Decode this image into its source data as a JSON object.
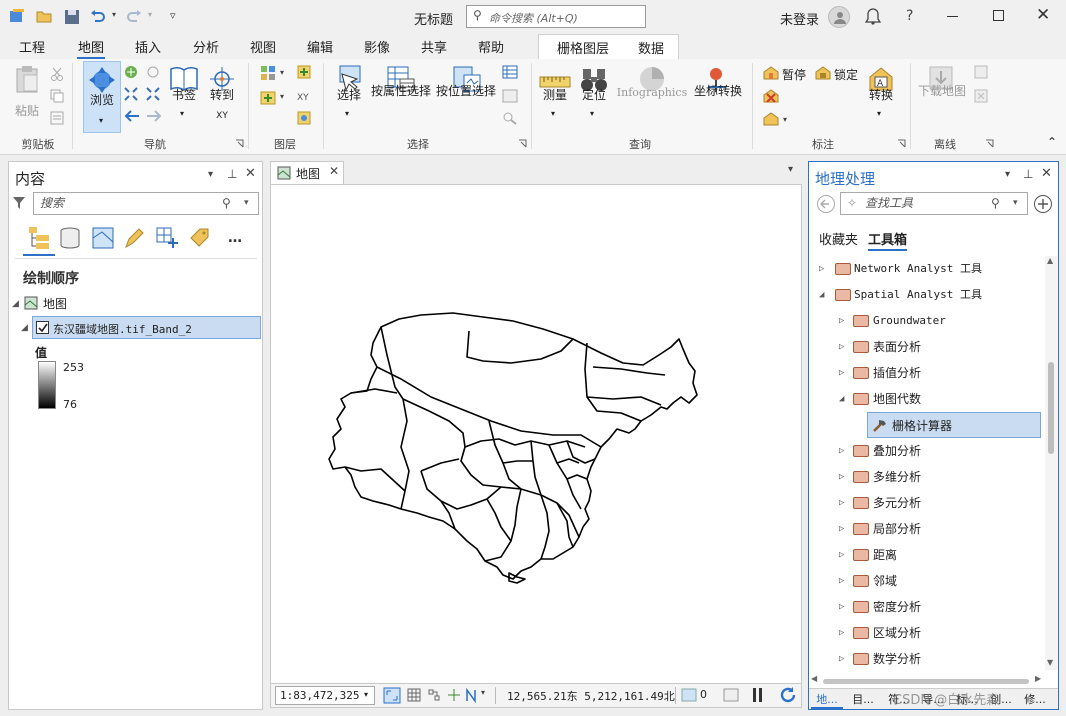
{
  "titlebar": {
    "doc_title": "无标题",
    "command_search_placeholder": "命令搜索 (Alt+Q)",
    "login_label": "未登录",
    "help_label": "?"
  },
  "ribbon_tabs": [
    "工程",
    "地图",
    "插入",
    "分析",
    "视图",
    "编辑",
    "影像",
    "共享",
    "帮助"
  ],
  "ribbon_active_tab": "地图",
  "context_tabs": [
    "栅格图层",
    "数据"
  ],
  "ribbon": {
    "paste": "粘贴",
    "browse": "浏览",
    "bookmark": "书签",
    "goto_xy": "转到",
    "goto_xy_sub": "XY",
    "select": "选择",
    "select_by_attr": "按属性选择",
    "select_by_loc": "按位置选择",
    "measure": "测量",
    "locate": "定位",
    "infographics": "Infographics",
    "coord_convert": "坐标转换",
    "pause": "暂停",
    "lock": "锁定",
    "convert": "转换",
    "download_map": "下载地图",
    "groups": {
      "clipboard": "剪贴板",
      "navigate": "导航",
      "layer": "图层",
      "selection": "选择",
      "inquiry": "查询",
      "labeling": "标注",
      "offline": "离线"
    }
  },
  "contents": {
    "title": "内容",
    "search_placeholder": "搜索",
    "drawing_order": "绘制顺序",
    "map_name": "地图",
    "layer_name": "东汉疆域地图.tif_Band_2",
    "layer_checked": true,
    "legend_title": "值",
    "legend_max": "253",
    "legend_min": "76"
  },
  "map_view": {
    "tab_label": "地图",
    "scale": "1:83,472,325",
    "coords": "12,565.21东 5,212,161.49北",
    "selected_count": "0"
  },
  "geoprocessing": {
    "title": "地理处理",
    "search_placeholder": "查找工具",
    "tabs": [
      "收藏夹",
      "工具箱"
    ],
    "active_tab": "工具箱",
    "tree": [
      {
        "label": "Network Analyst 工具",
        "level": 0,
        "expanded": false
      },
      {
        "label": "Spatial Analyst 工具",
        "level": 0,
        "expanded": true
      },
      {
        "label": "Groundwater",
        "level": 1,
        "expanded": false
      },
      {
        "label": "表面分析",
        "level": 1,
        "expanded": false
      },
      {
        "label": "插值分析",
        "level": 1,
        "expanded": false
      },
      {
        "label": "地图代数",
        "level": 1,
        "expanded": true
      },
      {
        "label": "栅格计算器",
        "level": 2,
        "tool": true,
        "selected": true
      },
      {
        "label": "叠加分析",
        "level": 1,
        "expanded": false
      },
      {
        "label": "多维分析",
        "level": 1,
        "expanded": false
      },
      {
        "label": "多元分析",
        "level": 1,
        "expanded": false
      },
      {
        "label": "局部分析",
        "level": 1,
        "expanded": false
      },
      {
        "label": "距离",
        "level": 1,
        "expanded": false
      },
      {
        "label": "邻域",
        "level": 1,
        "expanded": false
      },
      {
        "label": "密度分析",
        "level": 1,
        "expanded": false
      },
      {
        "label": "区域分析",
        "level": 1,
        "expanded": false
      },
      {
        "label": "数学分析",
        "level": 1,
        "expanded": false
      }
    ],
    "bottom_tabs": [
      "地...",
      "目...",
      "符...",
      "导...",
      "标...",
      "创...",
      "修..."
    ],
    "watermark": "CSDN @白水先森"
  },
  "colors": {
    "accent": "#2b70c9",
    "selection_bg": "#c9dcf2",
    "selection_border": "#7aa7dd"
  }
}
